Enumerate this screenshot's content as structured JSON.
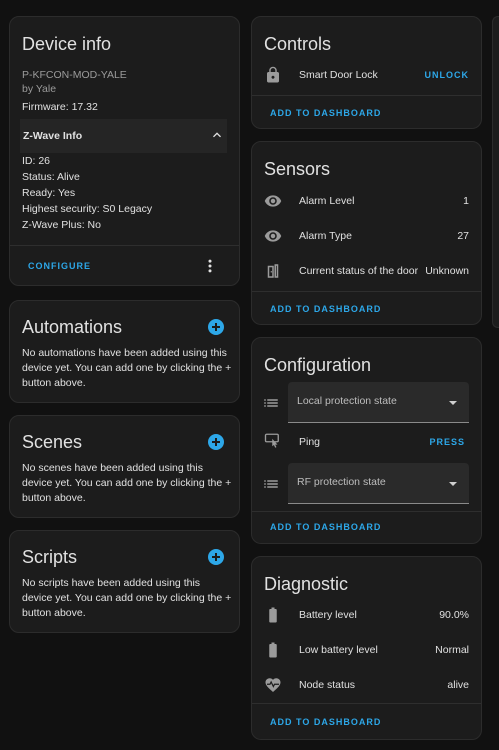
{
  "device_info": {
    "title": "Device info",
    "model": "P-KFCON-MOD-YALE",
    "manufacturer": "by Yale",
    "firmware": "Firmware: 17.32",
    "zwave_header": "Z-Wave Info",
    "zwave_lines": [
      "ID: 26",
      "Status: Alive",
      "Ready: Yes",
      "Highest security: S0 Legacy",
      "Z-Wave Plus: No"
    ],
    "configure_label": "CONFIGURE"
  },
  "automations": {
    "title": "Automations",
    "text": "No automations have been added using this device yet. You can add one by clicking the + button above."
  },
  "scenes": {
    "title": "Scenes",
    "text": "No scenes have been added using this device yet. You can add one by clicking the + button above."
  },
  "scripts": {
    "title": "Scripts",
    "text": "No scripts have been added using this device yet. You can add one by clicking the + button above."
  },
  "controls": {
    "title": "Controls",
    "lock_label": "Smart Door Lock",
    "lock_action": "UNLOCK",
    "add_label": "ADD TO DASHBOARD"
  },
  "sensors": {
    "title": "Sensors",
    "rows": [
      {
        "label": "Alarm Level",
        "value": "1",
        "icon": "eye-icon"
      },
      {
        "label": "Alarm Type",
        "value": "27",
        "icon": "eye-icon"
      },
      {
        "label": "Current status of the door",
        "value": "Unknown",
        "icon": "door-icon"
      }
    ],
    "add_label": "ADD TO DASHBOARD"
  },
  "configuration": {
    "title": "Configuration",
    "select1": "Local protection state",
    "ping_label": "Ping",
    "ping_action": "PRESS",
    "select2": "RF protection state",
    "add_label": "ADD TO DASHBOARD"
  },
  "diagnostic": {
    "title": "Diagnostic",
    "rows": [
      {
        "label": "Battery level",
        "value": "90.0%",
        "icon": "battery-icon"
      },
      {
        "label": "Low battery level",
        "value": "Normal",
        "icon": "battery-icon"
      },
      {
        "label": "Node status",
        "value": "alive",
        "icon": "heart-pulse-icon"
      }
    ],
    "add_label": "ADD TO DASHBOARD"
  },
  "colors": {
    "accent": "#2da7e8",
    "card": "#1c1c1c",
    "background": "#111111"
  }
}
